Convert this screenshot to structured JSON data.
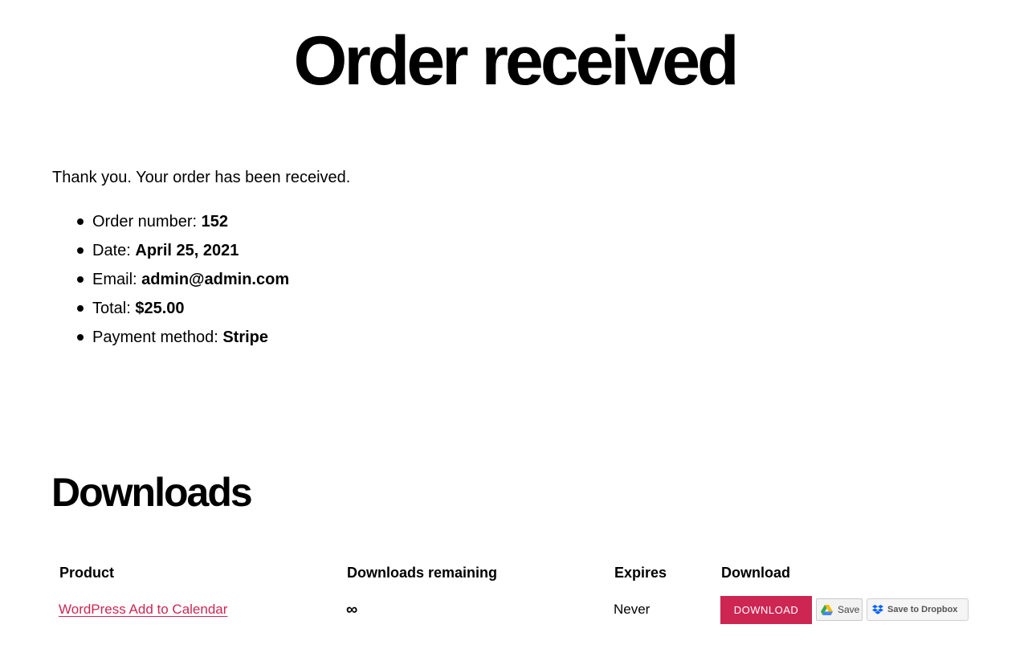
{
  "page": {
    "title": "Order received"
  },
  "order": {
    "thank_you": "Thank you. Your order has been received.",
    "details": [
      {
        "label": "Order number:",
        "value": "152"
      },
      {
        "label": "Date:",
        "value": "April 25, 2021"
      },
      {
        "label": "Email:",
        "value": "admin@admin.com"
      },
      {
        "label": "Total:",
        "value": "$25.00"
      },
      {
        "label": "Payment method:",
        "value": "Stripe"
      }
    ]
  },
  "downloads": {
    "title": "Downloads",
    "columns": [
      "Product",
      "Downloads remaining",
      "Expires",
      "Download"
    ],
    "rows": [
      {
        "product": "WordPress Add to Calendar",
        "remaining": "∞",
        "expires": "Never",
        "download_label": "DOWNLOAD",
        "gdrive_label": "Save",
        "dropbox_label": "Save to Dropbox"
      }
    ]
  },
  "colors": {
    "accent": "#cd2653",
    "text": "#000000",
    "background": "#ffffff"
  },
  "icons": {
    "gdrive": "google-drive-icon",
    "dropbox": "dropbox-icon"
  }
}
